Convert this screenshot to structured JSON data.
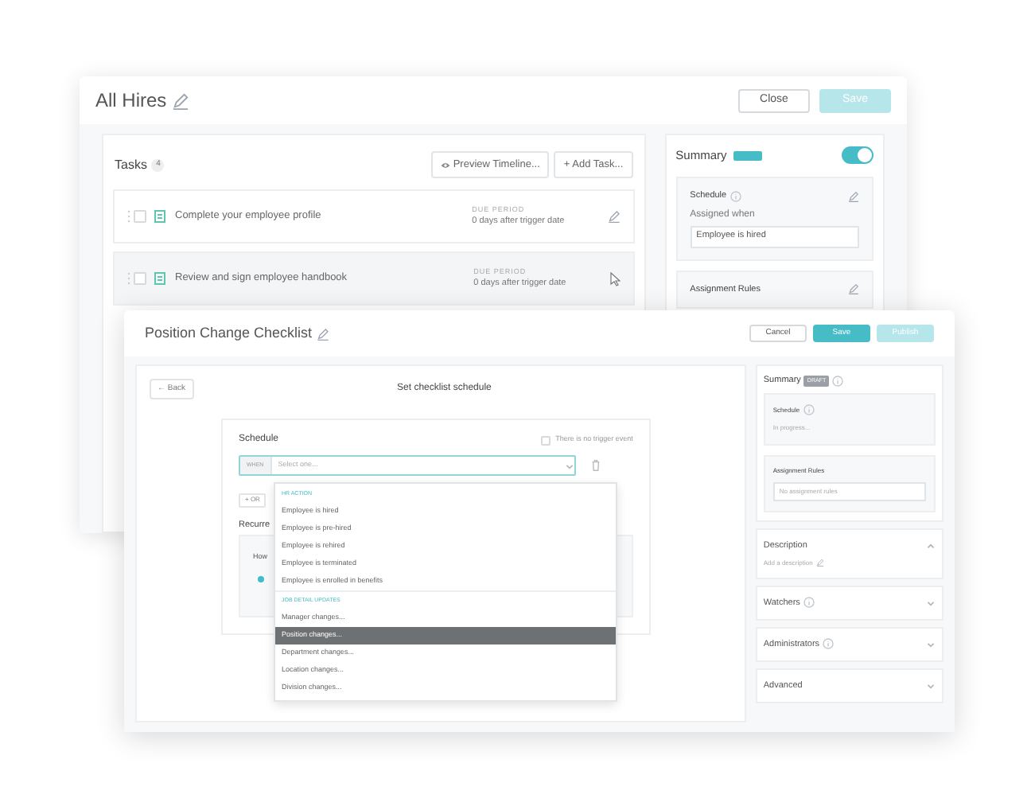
{
  "back_window": {
    "title": "All Hires",
    "buttons": [
      {
        "label": "Close",
        "kind": "secondary",
        "disabled": false
      },
      {
        "label": "Save",
        "kind": "primary",
        "disabled": true
      }
    ],
    "tasks": {
      "title": "Tasks",
      "count": "4",
      "actions": [
        "Preview Timeline...",
        "+ Add Task..."
      ],
      "rows": [
        {
          "name": "Complete your employee profile",
          "due_label": "DUE PERIOD",
          "due": "0 days after trigger date",
          "hovered": false
        },
        {
          "name": "Review and sign employee handbook",
          "due_label": "DUE PERIOD",
          "due": "0 days after trigger date",
          "hovered": true
        }
      ]
    },
    "summary": {
      "title": "Summary",
      "toggle_on": true,
      "schedule": {
        "title": "Schedule",
        "label": "Assigned when",
        "value": "Employee is hired"
      },
      "assignment_rules": {
        "title": "Assignment Rules"
      }
    }
  },
  "front_window": {
    "title": "Position Change Checklist",
    "buttons": [
      {
        "label": "Cancel",
        "kind": "secondary",
        "disabled": false
      },
      {
        "label": "Save",
        "kind": "primary",
        "disabled": false
      },
      {
        "label": "Publish",
        "kind": "primary",
        "disabled": true
      }
    ],
    "schedule_form": {
      "back": "← Back",
      "heading": "Set checklist schedule",
      "title": "Schedule",
      "no_trigger": {
        "label": "There is no trigger event",
        "checked": false
      },
      "select": {
        "prefix": "WHEN",
        "placeholder": "Select one..."
      },
      "or_button": "+ OR",
      "recurrence_title": "Recurre",
      "recurrence_question": "How",
      "radio_selected": true
    },
    "dropdown": {
      "groups": [
        {
          "title": "HR ACTION",
          "items": [
            {
              "label": "Employee is hired",
              "selected": false
            },
            {
              "label": "Employee is pre-hired",
              "selected": false
            },
            {
              "label": "Employee is rehired",
              "selected": false
            },
            {
              "label": "Employee is terminated",
              "selected": false
            },
            {
              "label": "Employee is enrolled in benefits",
              "selected": false
            }
          ]
        },
        {
          "title": "JOB DETAIL UPDATES",
          "items": [
            {
              "label": "Manager changes...",
              "selected": false
            },
            {
              "label": "Position changes...",
              "selected": true
            },
            {
              "label": "Department changes...",
              "selected": false
            },
            {
              "label": "Location changes...",
              "selected": false
            },
            {
              "label": "Division changes...",
              "selected": false
            }
          ]
        }
      ]
    },
    "summary": {
      "title": "Summary",
      "badge": "DRAFT",
      "schedule": {
        "title": "Schedule",
        "value": "In progress..."
      },
      "assignment_rules": {
        "title": "Assignment Rules",
        "placeholder": "No assignment rules"
      }
    },
    "sections": [
      {
        "title": "Description",
        "info": false,
        "expanded": true,
        "link": "Add a description"
      },
      {
        "title": "Watchers",
        "info": true,
        "expanded": false
      },
      {
        "title": "Administrators",
        "info": true,
        "expanded": false
      },
      {
        "title": "Advanced",
        "info": false,
        "expanded": false
      }
    ]
  }
}
